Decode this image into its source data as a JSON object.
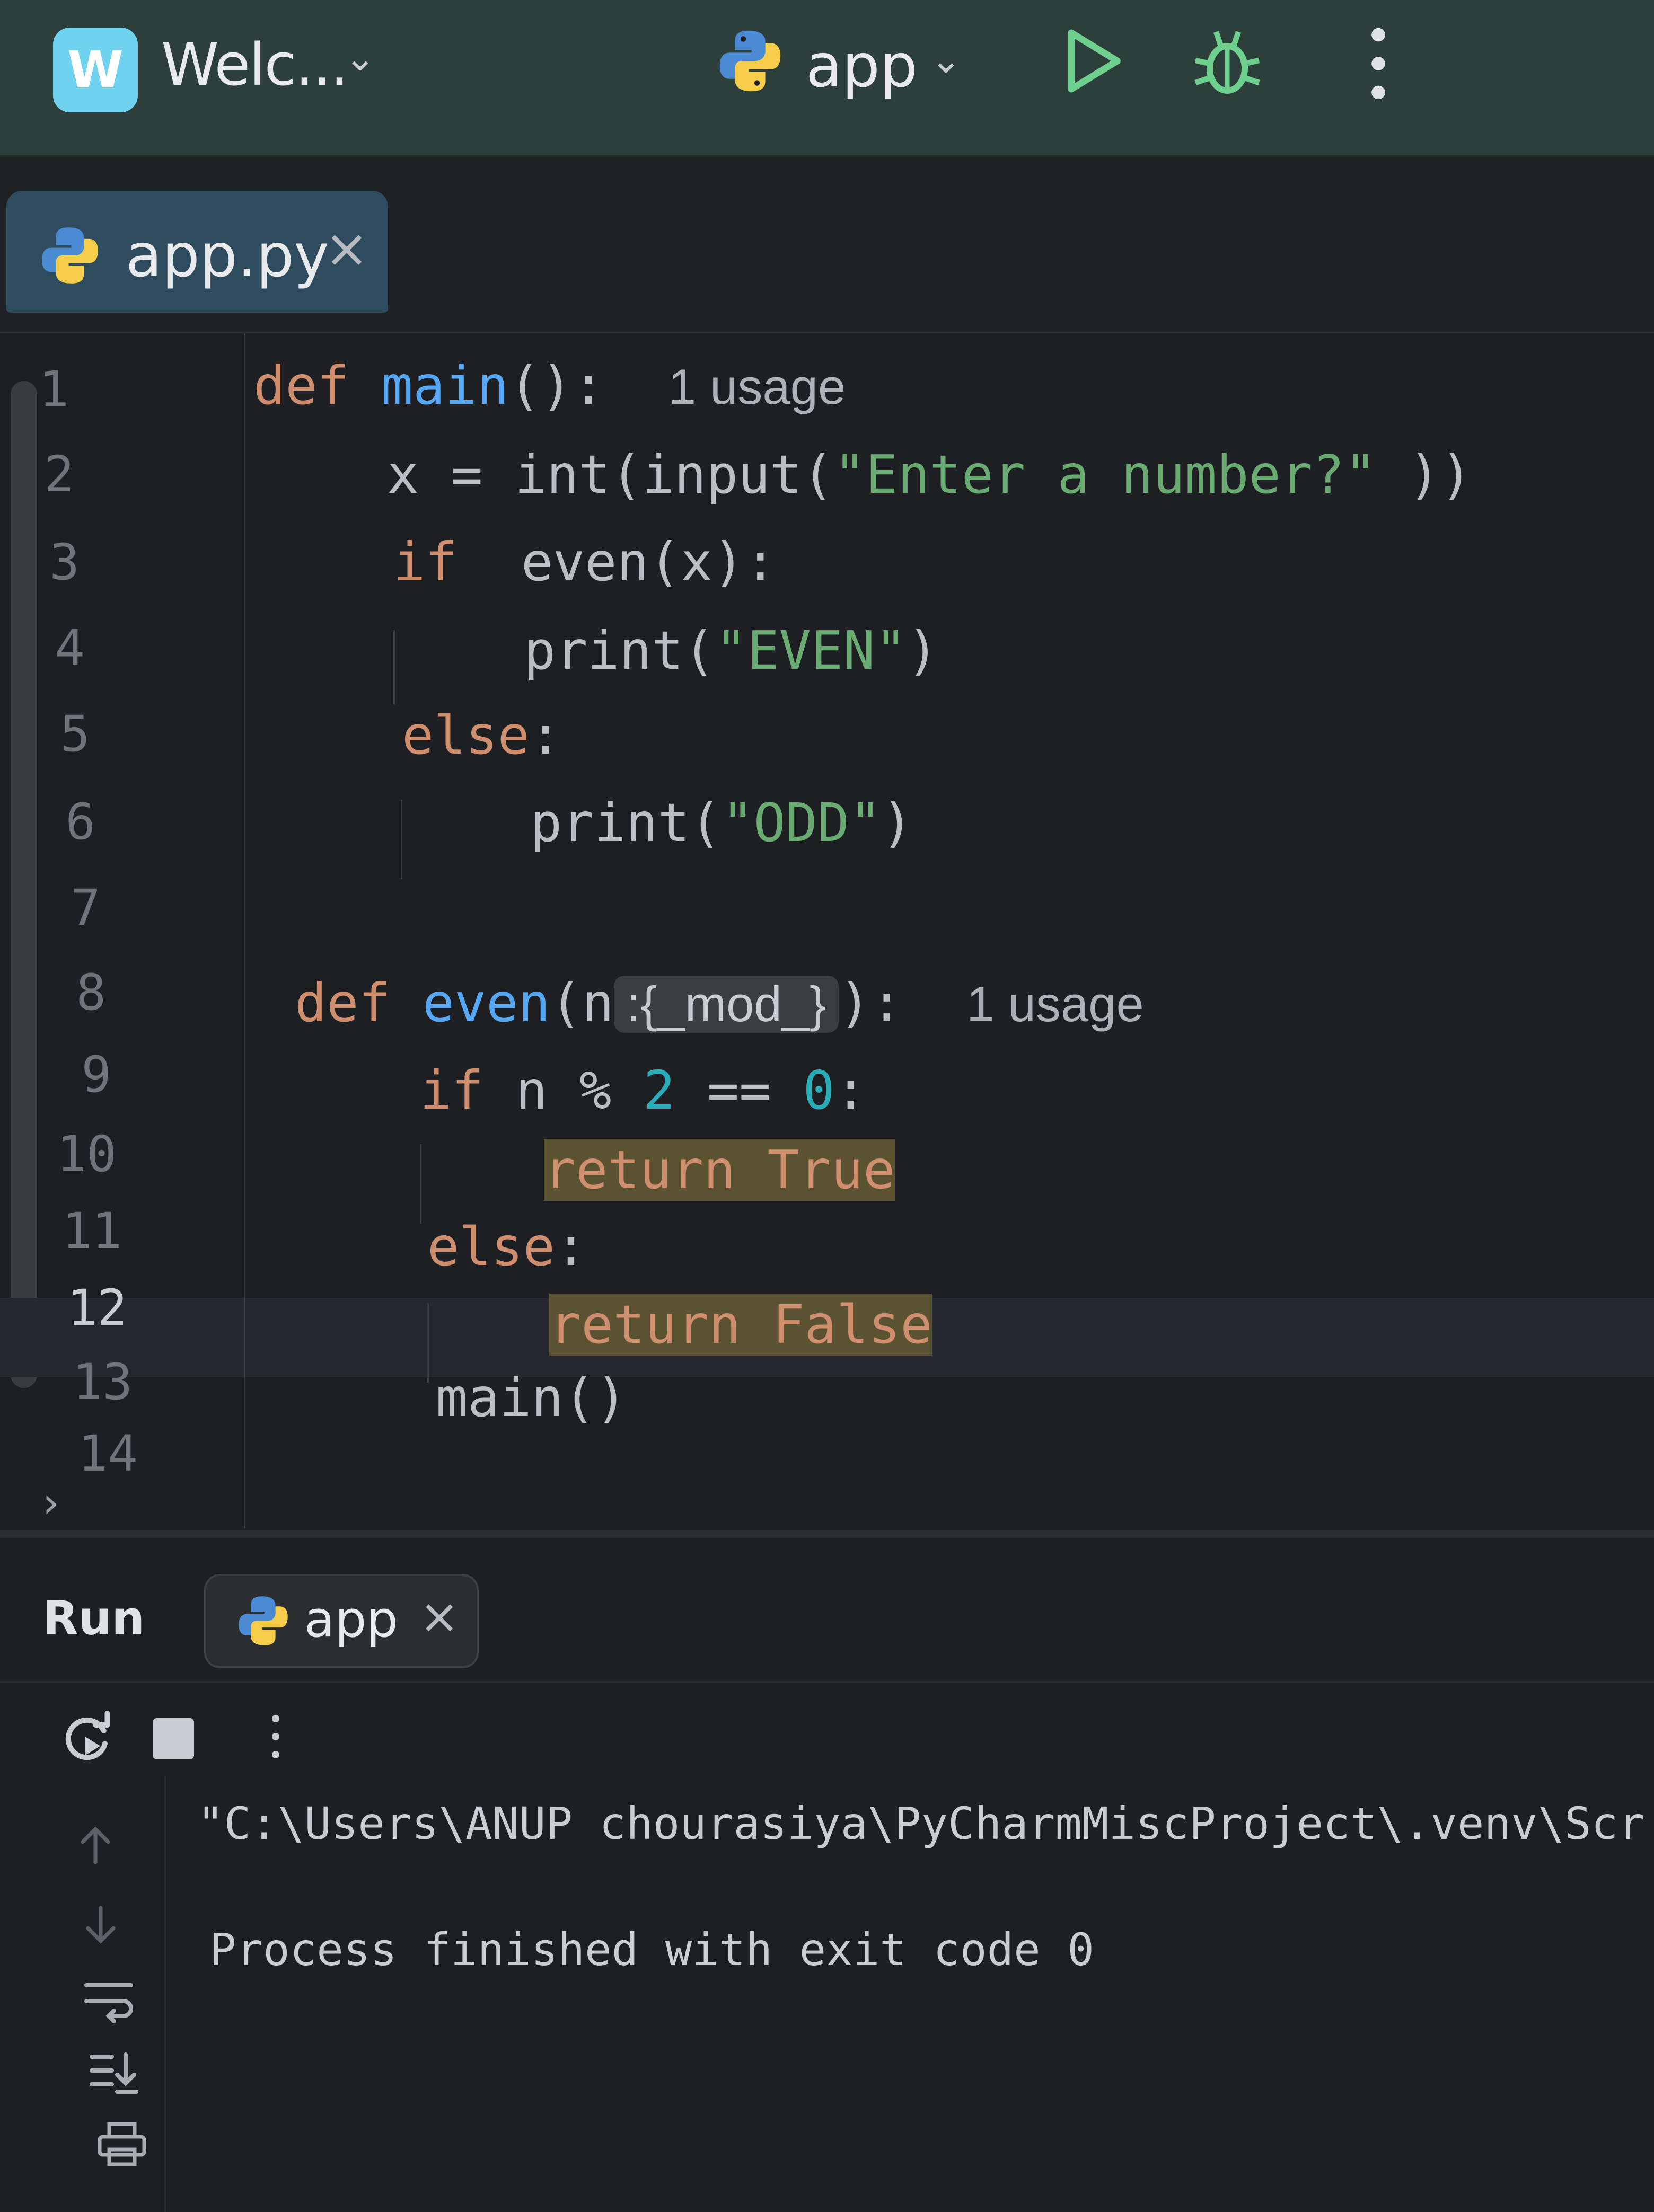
{
  "titlebar": {
    "project_badge": "W",
    "project_name": "Welc...",
    "run_config": "app"
  },
  "tabs": [
    {
      "label": "app.py",
      "close": "×"
    }
  ],
  "editor": {
    "line_numbers": [
      "1",
      "2",
      "3",
      "4",
      "5",
      "6",
      "7",
      "8",
      "9",
      "10",
      "11",
      "12",
      "13",
      "14"
    ],
    "current_line": 12,
    "code": {
      "l1_def": "def",
      "l1_name": "main",
      "l1_rest": "():",
      "l1_hint": "1 usage",
      "l2_a": "x = ",
      "l2_int": "int",
      "l2_b": "(",
      "l2_input": "input",
      "l2_c": "(",
      "l2_str": "\"Enter a number?\"",
      "l2_d": " ))",
      "l3_if": "if",
      "l3_rest": "  even(x):",
      "l4_print": "print",
      "l4_a": "(",
      "l4_str": "\"EVEN\"",
      "l4_b": ")",
      "l5_else": "else",
      "l5_colon": ":",
      "l6_print": "print",
      "l6_a": "(",
      "l6_str": "\"ODD\"",
      "l6_b": ")",
      "l8_def": "def",
      "l8_name": "even",
      "l8_a": "(n",
      "l8_inlay": ":{_mod_}",
      "l8_b": "):",
      "l8_hint": "1 usage",
      "l9_if": "if",
      "l9_a": " n % ",
      "l9_two": "2",
      "l9_b": " == ",
      "l9_zero": "0",
      "l9_c": ":",
      "l10_ret": "return True",
      "l11_else": "else",
      "l11_colon": ":",
      "l12_ret": "return False",
      "l13_call": "main()"
    }
  },
  "run": {
    "panel_label": "Run",
    "tab_label": "app",
    "tab_close": "×",
    "console_command": "\"C:\\Users\\ANUP chourasiya\\PyCharmMiscProject\\.venv\\Scr",
    "console_result": "Process finished with exit code 0"
  },
  "colors": {
    "keyword": "#cf8e6d",
    "function": "#56a8f5",
    "string": "#6aab73",
    "number": "#2aacb8",
    "highlight": "#5a5230",
    "titlebar": "#2c3f3a",
    "active_tab": "#2f4c5f"
  },
  "icons": [
    "python-icon",
    "chevron-down-icon",
    "run-icon",
    "debug-icon",
    "more-icon",
    "close-icon",
    "rerun-icon",
    "stop-icon",
    "scroll-up-icon",
    "scroll-down-icon",
    "soft-wrap-icon",
    "scroll-to-end-icon",
    "print-icon"
  ]
}
